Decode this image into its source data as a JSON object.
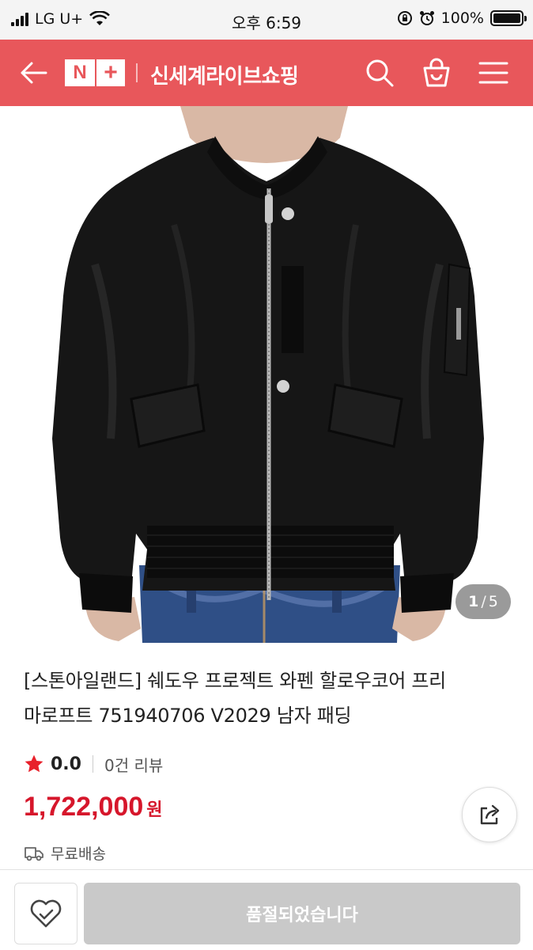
{
  "status_bar": {
    "carrier": "LG U+",
    "time": "오후 6:59",
    "battery": "100%"
  },
  "header": {
    "logo_n": "N",
    "logo_plus": "+",
    "title": "신세계라이브쇼핑",
    "icons": [
      "back-arrow-icon",
      "search-icon",
      "shopping-bag-icon",
      "menu-icon"
    ],
    "bg_color": "#e8575b"
  },
  "gallery": {
    "current": "1",
    "separator": "/",
    "total": "5"
  },
  "product": {
    "title_line1": "[스톤아일랜드] 쉐도우 프로젝트 와펜 할로우코어 프리",
    "title_line2": "마로프트 751940706 V2029 남자 패딩",
    "rating": "0.0",
    "review_count": "0건 리뷰",
    "price": "1,722,000",
    "price_unit": "원",
    "shipping": "무료배송",
    "price_color": "#d6162b"
  },
  "bottom": {
    "soldout_label": "품절되었습니다"
  }
}
